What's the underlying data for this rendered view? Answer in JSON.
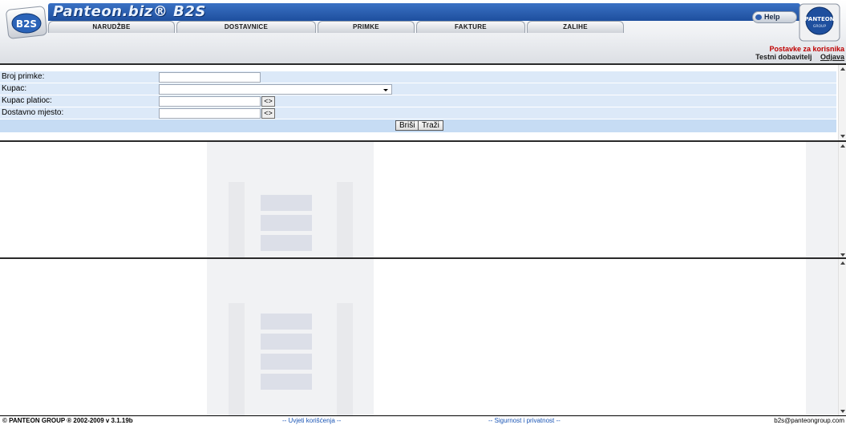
{
  "header": {
    "brand": "Panteon.biz® B2S",
    "logo_left_text": "B2S",
    "logo_right_text": "PANTEON",
    "logo_right_sub": "GROUP",
    "help_label": "Help",
    "tabs": [
      {
        "label": "NARUDŽBE"
      },
      {
        "label": "DOSTAVNICE"
      },
      {
        "label": "PRIMKE"
      },
      {
        "label": "FAKTURE"
      },
      {
        "label": "ZALIHE"
      }
    ],
    "user_settings": "Postavke za korisnika",
    "user_name": "Testni dobavitelj",
    "logout": "Odjava"
  },
  "search": {
    "fields": [
      {
        "label": "Broj primke:",
        "value": ""
      },
      {
        "label": "Kupac:",
        "value": ""
      },
      {
        "label": "Kupac platioc:",
        "value": "",
        "button": "<>"
      },
      {
        "label": "Dostavno mjesto:",
        "value": "",
        "button": "<>"
      }
    ],
    "clear_button": "Briši",
    "search_button": "Traži"
  },
  "footer": {
    "copyright": "© PANTEON GROUP ® 2002-2009 v 3.1.19b",
    "terms": "-- Uvjeti korišćenja --",
    "privacy": "-- Sigurnost i privatnost --",
    "email": "b2s@panteongroup.com"
  },
  "colors": {
    "brand_blue": "#2a5fb4",
    "accent_red": "#c00000",
    "form_bg": "#dce9f8",
    "link_blue": "#1a55b5"
  }
}
